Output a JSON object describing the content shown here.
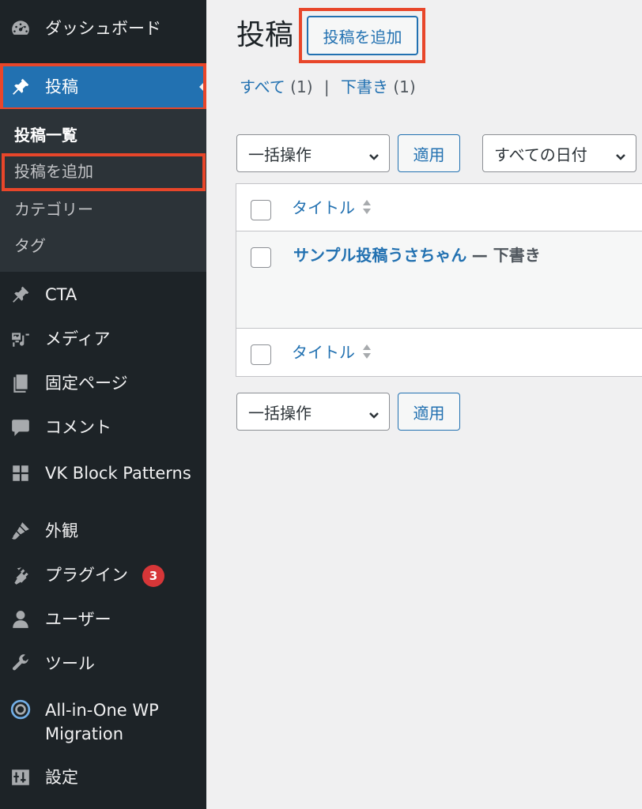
{
  "sidebar": {
    "dashboard": "ダッシュボード",
    "posts": "投稿",
    "submenu": {
      "all_posts": "投稿一覧",
      "add_new": "投稿を追加",
      "categories": "カテゴリー",
      "tags": "タグ"
    },
    "cta": "CTA",
    "media": "メディア",
    "pages": "固定ページ",
    "comments": "コメント",
    "vk_block_patterns": "VK Block Patterns",
    "appearance": "外観",
    "plugins": "プラグイン",
    "plugins_badge": "3",
    "users": "ユーザー",
    "tools": "ツール",
    "aio_migration": "All-in-One WP Migration",
    "settings": "設定"
  },
  "main": {
    "page_title": "投稿",
    "add_new_button": "投稿を追加",
    "filters": {
      "all_label": "すべて",
      "all_count": "(1)",
      "separator": "|",
      "draft_label": "下書き",
      "draft_count": "(1)"
    },
    "bulk_actions": "一括操作",
    "apply": "適用",
    "date_filter": "すべての日付",
    "table": {
      "column_title": "タイトル",
      "rows": [
        {
          "title": "サンプル投稿うさちゃん",
          "state": "— 下書き"
        }
      ]
    }
  },
  "colors": {
    "sidebar_bg": "#1d2327",
    "submenu_bg": "#2c3338",
    "accent": "#2271b1",
    "highlight": "#e8462a",
    "badge": "#d63638"
  }
}
